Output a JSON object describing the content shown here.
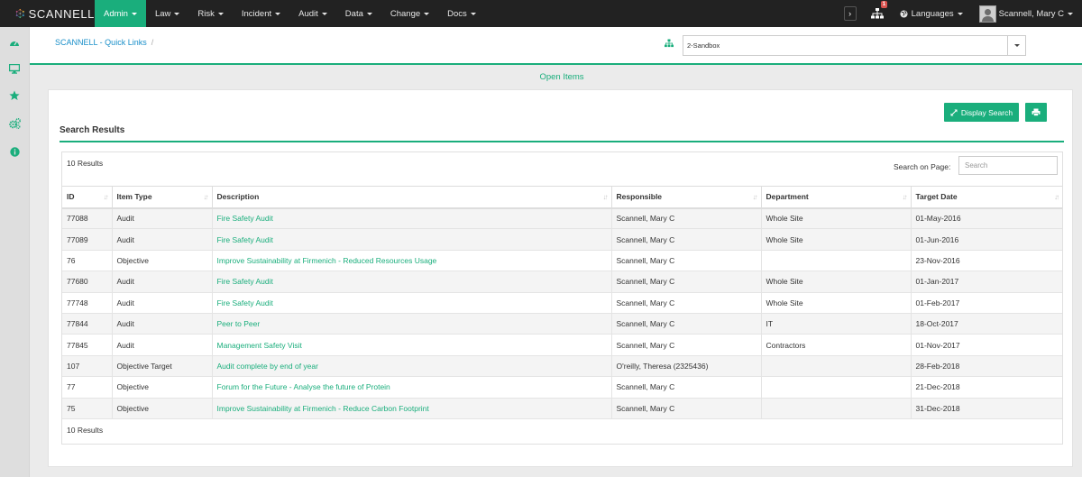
{
  "brand": {
    "name": "SCANNELL",
    "logo_icon": "network-logo-icon"
  },
  "nav": {
    "items": [
      {
        "label": "Admin",
        "active": true
      },
      {
        "label": "Law",
        "active": false
      },
      {
        "label": "Risk",
        "active": false
      },
      {
        "label": "Incident",
        "active": false
      },
      {
        "label": "Audit",
        "active": false
      },
      {
        "label": "Data",
        "active": false
      },
      {
        "label": "Change",
        "active": false
      },
      {
        "label": "Docs",
        "active": false
      }
    ],
    "notification_count": "1",
    "languages_label": "Languages",
    "user_name": "Scannell, Mary C"
  },
  "sidebar": {
    "icons": [
      "dashboard-icon",
      "monitor-icon",
      "star-icon",
      "cogs-icon",
      "info-icon"
    ]
  },
  "header": {
    "breadcrumb": "SCANNELL - Quick Links",
    "breadcrumb_separator": "/",
    "environment": "2-Sandbox"
  },
  "page": {
    "subtitle": "Open Items",
    "display_search_label": "Display Search",
    "section_title": "Search Results",
    "results_count_top": "10 Results",
    "results_count_bottom": "10 Results",
    "search_label": "Search on Page:",
    "search_placeholder": "Search"
  },
  "table": {
    "columns": [
      "ID",
      "Item Type",
      "Description",
      "Responsible",
      "Department",
      "Target Date"
    ],
    "rows": [
      [
        "77088",
        "Audit",
        "Fire Safety Audit",
        "Scannell, Mary C",
        "Whole Site",
        "01-May-2016"
      ],
      [
        "77089",
        "Audit",
        "Fire Safety Audit",
        "Scannell, Mary C",
        "Whole Site",
        "01-Jun-2016"
      ],
      [
        "76",
        "Objective",
        "Improve Sustainability at Firmenich - Reduced Resources Usage",
        "Scannell, Mary C",
        "",
        "23-Nov-2016"
      ],
      [
        "77680",
        "Audit",
        "Fire Safety Audit",
        "Scannell, Mary C",
        "Whole Site",
        "01-Jan-2017"
      ],
      [
        "77748",
        "Audit",
        "Fire Safety Audit",
        "Scannell, Mary C",
        "Whole Site",
        "01-Feb-2017"
      ],
      [
        "77844",
        "Audit",
        "Peer to Peer",
        "Scannell, Mary C",
        "IT",
        "18-Oct-2017"
      ],
      [
        "77845",
        "Audit",
        "Management Safety Visit",
        "Scannell, Mary C",
        "Contractors",
        "01-Nov-2017"
      ],
      [
        "107",
        "Objective Target",
        "Audit complete by end of year",
        "O'reilly, Theresa (2325436)",
        "",
        "28-Feb-2018"
      ],
      [
        "77",
        "Objective",
        "Forum for the Future - Analyse the future of Protein",
        "Scannell, Mary C",
        "",
        "21-Dec-2018"
      ],
      [
        "75",
        "Objective",
        "Improve Sustainability at Firmenich - Reduce Carbon Footprint",
        "Scannell, Mary C",
        "",
        "31-Dec-2018"
      ]
    ]
  },
  "colors": {
    "accent": "#1aae7c",
    "navbar": "#222222",
    "link_blue": "#1a8fc9"
  }
}
